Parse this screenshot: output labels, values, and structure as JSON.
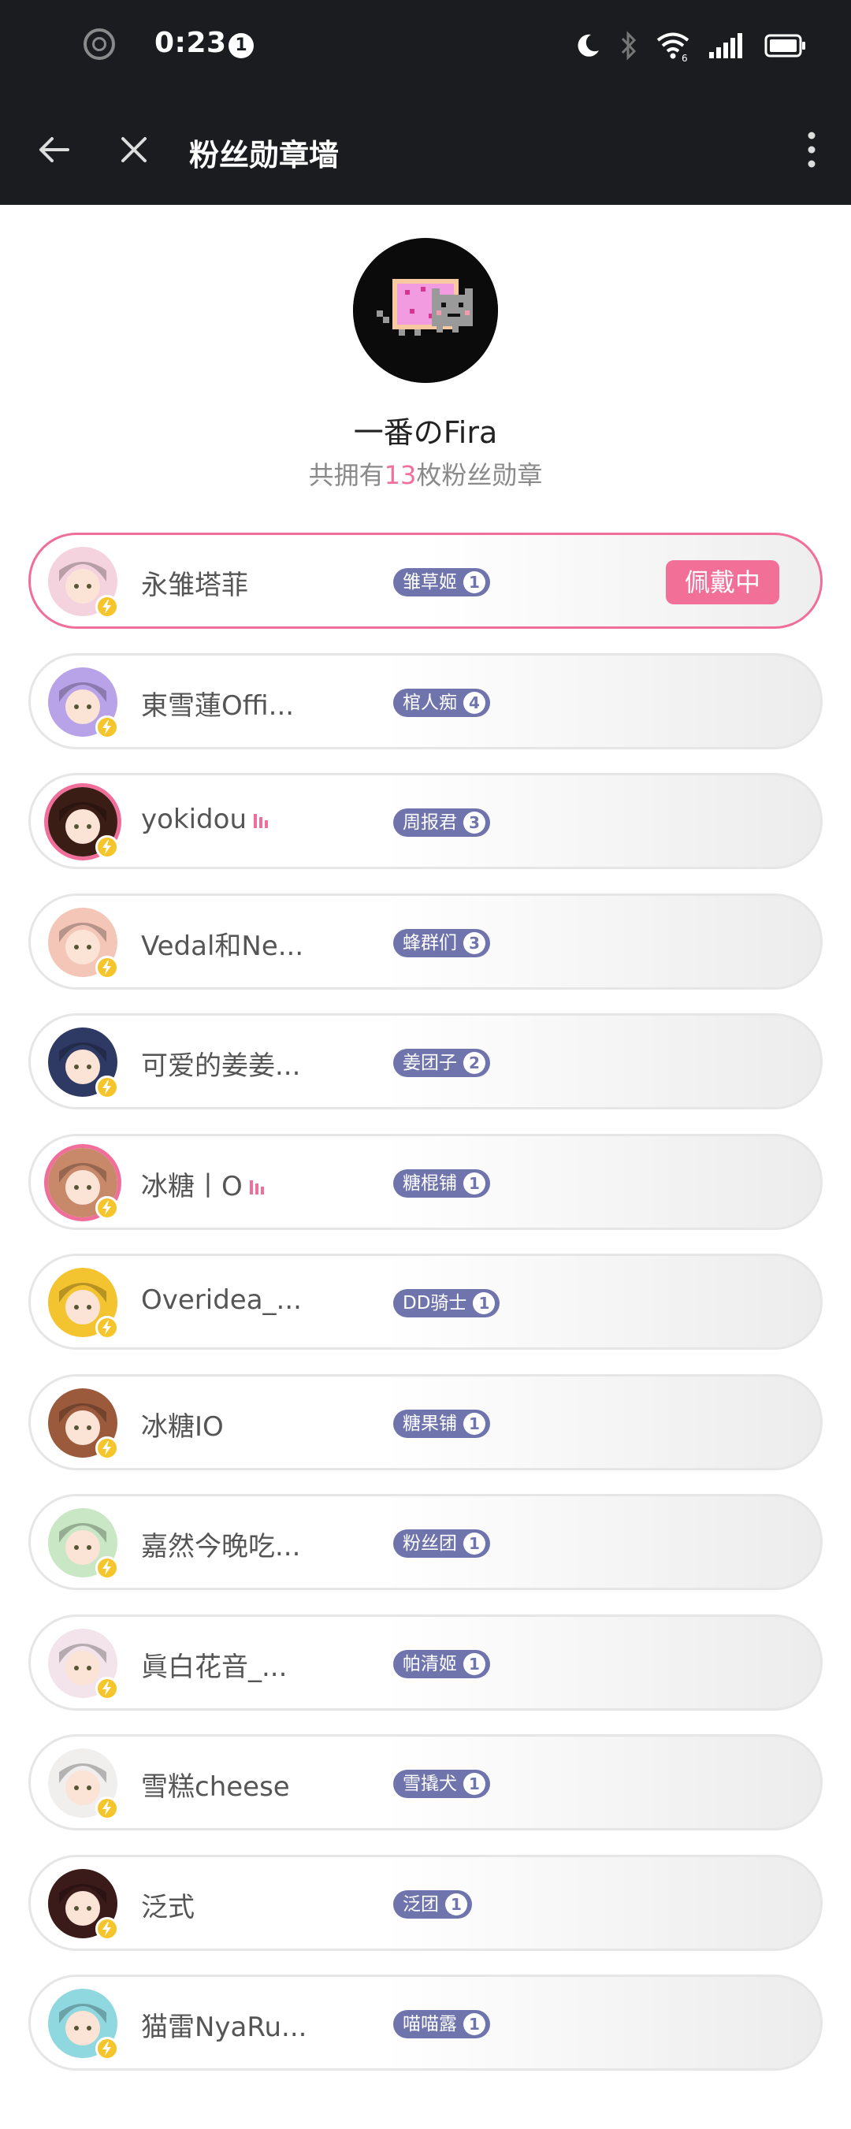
{
  "status_bar": {
    "time": "0:23",
    "notification_count": "1",
    "signal_label": "6"
  },
  "app_bar": {
    "title": "粉丝勋章墙"
  },
  "profile": {
    "name": "一番のFira",
    "summary_prefix": "共拥有",
    "summary_count": "13",
    "summary_suffix": "枚粉丝勋章"
  },
  "medals": [
    {
      "name": "永雏塔菲",
      "badge": "雏草姬",
      "level": "1",
      "wearing_label": "佩戴中",
      "avatar_color": "#f4d3df",
      "ring": false,
      "live": false
    },
    {
      "name": "東雪蓮Offi...",
      "badge": "棺人痴",
      "level": "4",
      "avatar_color": "#b9a3e8",
      "ring": false,
      "live": false
    },
    {
      "name": "yokidou",
      "badge": "周报君",
      "level": "3",
      "avatar_color": "#3a1d14",
      "ring": true,
      "live": true
    },
    {
      "name": "Vedal和Ne...",
      "badge": "蜂群们",
      "level": "3",
      "avatar_color": "#f3c6b7",
      "ring": false,
      "live": false
    },
    {
      "name": "可爱的姜姜...",
      "badge": "姜团子",
      "level": "2",
      "avatar_color": "#2e3a63",
      "ring": false,
      "live": false
    },
    {
      "name": "冰糖丨O",
      "badge": "糖棍铺",
      "level": "1",
      "avatar_color": "#c8896a",
      "ring": true,
      "live": true
    },
    {
      "name": "Overidea_...",
      "badge": "DD骑士",
      "level": "1",
      "avatar_color": "#f4c430",
      "ring": false,
      "live": false
    },
    {
      "name": "冰糖IO",
      "badge": "糖果铺",
      "level": "1",
      "avatar_color": "#9b5a3c",
      "ring": false,
      "live": false
    },
    {
      "name": "嘉然今晚吃...",
      "badge": "粉丝团",
      "level": "1",
      "avatar_color": "#c9e7c5",
      "ring": false,
      "live": false
    },
    {
      "name": "眞白花音_...",
      "badge": "帕清姬",
      "level": "1",
      "avatar_color": "#f2e4ea",
      "ring": false,
      "live": false
    },
    {
      "name": "雪糕cheese",
      "badge": "雪撬犬",
      "level": "1",
      "avatar_color": "#f1eeee",
      "ring": false,
      "live": false
    },
    {
      "name": "泛式",
      "badge": "泛团",
      "level": "1",
      "avatar_color": "#3b1a1a",
      "ring": false,
      "live": false
    },
    {
      "name": "猫雷NyaRu...",
      "badge": "喵喵露",
      "level": "1",
      "avatar_color": "#8fd8e0",
      "ring": false,
      "live": false
    }
  ],
  "colors": {
    "accent_pink": "#f16e9a",
    "badge_purple": "#6f74ad",
    "bar_dark": "#1b1c1f"
  },
  "icons": {
    "back": "arrow-left-icon",
    "close": "close-icon",
    "more": "more-vertical-icon",
    "verified": "lightning-icon",
    "live": "live-bars-icon"
  }
}
